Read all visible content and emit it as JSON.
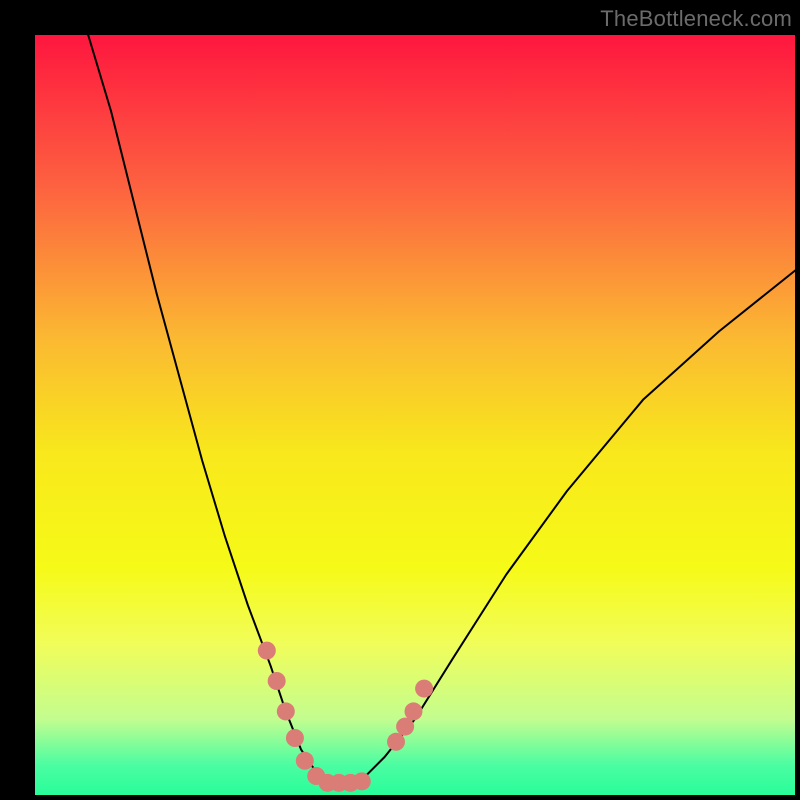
{
  "watermark": {
    "text": "TheBottleneck.com"
  },
  "chart_data": {
    "type": "line",
    "title": "",
    "xlabel": "",
    "ylabel": "",
    "xlim": [
      0,
      100
    ],
    "ylim": [
      0,
      100
    ],
    "grid": false,
    "legend": false,
    "gradient_stops": [
      {
        "offset": 0.0,
        "color": "#fe163f"
      },
      {
        "offset": 0.2,
        "color": "#fd6240"
      },
      {
        "offset": 0.4,
        "color": "#fbb932"
      },
      {
        "offset": 0.55,
        "color": "#f8e81c"
      },
      {
        "offset": 0.7,
        "color": "#f6fa17"
      },
      {
        "offset": 0.8,
        "color": "#f1fd59"
      },
      {
        "offset": 0.9,
        "color": "#c3fd8f"
      },
      {
        "offset": 0.96,
        "color": "#4cfda2"
      },
      {
        "offset": 1.0,
        "color": "#28fd9a"
      }
    ],
    "series": [
      {
        "name": "bottleneck-curve",
        "color": "#000000",
        "stroke_width": 2,
        "x": [
          7,
          10,
          13,
          16,
          19,
          22,
          25,
          28,
          31,
          33,
          35,
          37,
          38.5,
          40,
          43,
          46,
          50,
          55,
          62,
          70,
          80,
          90,
          100
        ],
        "y": [
          100,
          90,
          78,
          66,
          55,
          44,
          34,
          25,
          17,
          11,
          6,
          3,
          1.5,
          1.5,
          2,
          5,
          10,
          18,
          29,
          40,
          52,
          61,
          69
        ]
      }
    ],
    "markers": [
      {
        "name": "left-cluster",
        "color": "#da7d77",
        "size": 18,
        "points": [
          {
            "x": 30.5,
            "y": 19
          },
          {
            "x": 31.8,
            "y": 15
          },
          {
            "x": 33.0,
            "y": 11
          },
          {
            "x": 34.2,
            "y": 7.5
          },
          {
            "x": 35.5,
            "y": 4.5
          },
          {
            "x": 37.0,
            "y": 2.5
          },
          {
            "x": 38.5,
            "y": 1.6
          },
          {
            "x": 40.0,
            "y": 1.6
          },
          {
            "x": 41.5,
            "y": 1.6
          },
          {
            "x": 43.0,
            "y": 1.8
          }
        ]
      },
      {
        "name": "right-cluster",
        "color": "#da7d77",
        "size": 18,
        "points": [
          {
            "x": 47.5,
            "y": 7
          },
          {
            "x": 48.7,
            "y": 9
          },
          {
            "x": 49.8,
            "y": 11
          },
          {
            "x": 51.2,
            "y": 14
          }
        ]
      }
    ]
  }
}
